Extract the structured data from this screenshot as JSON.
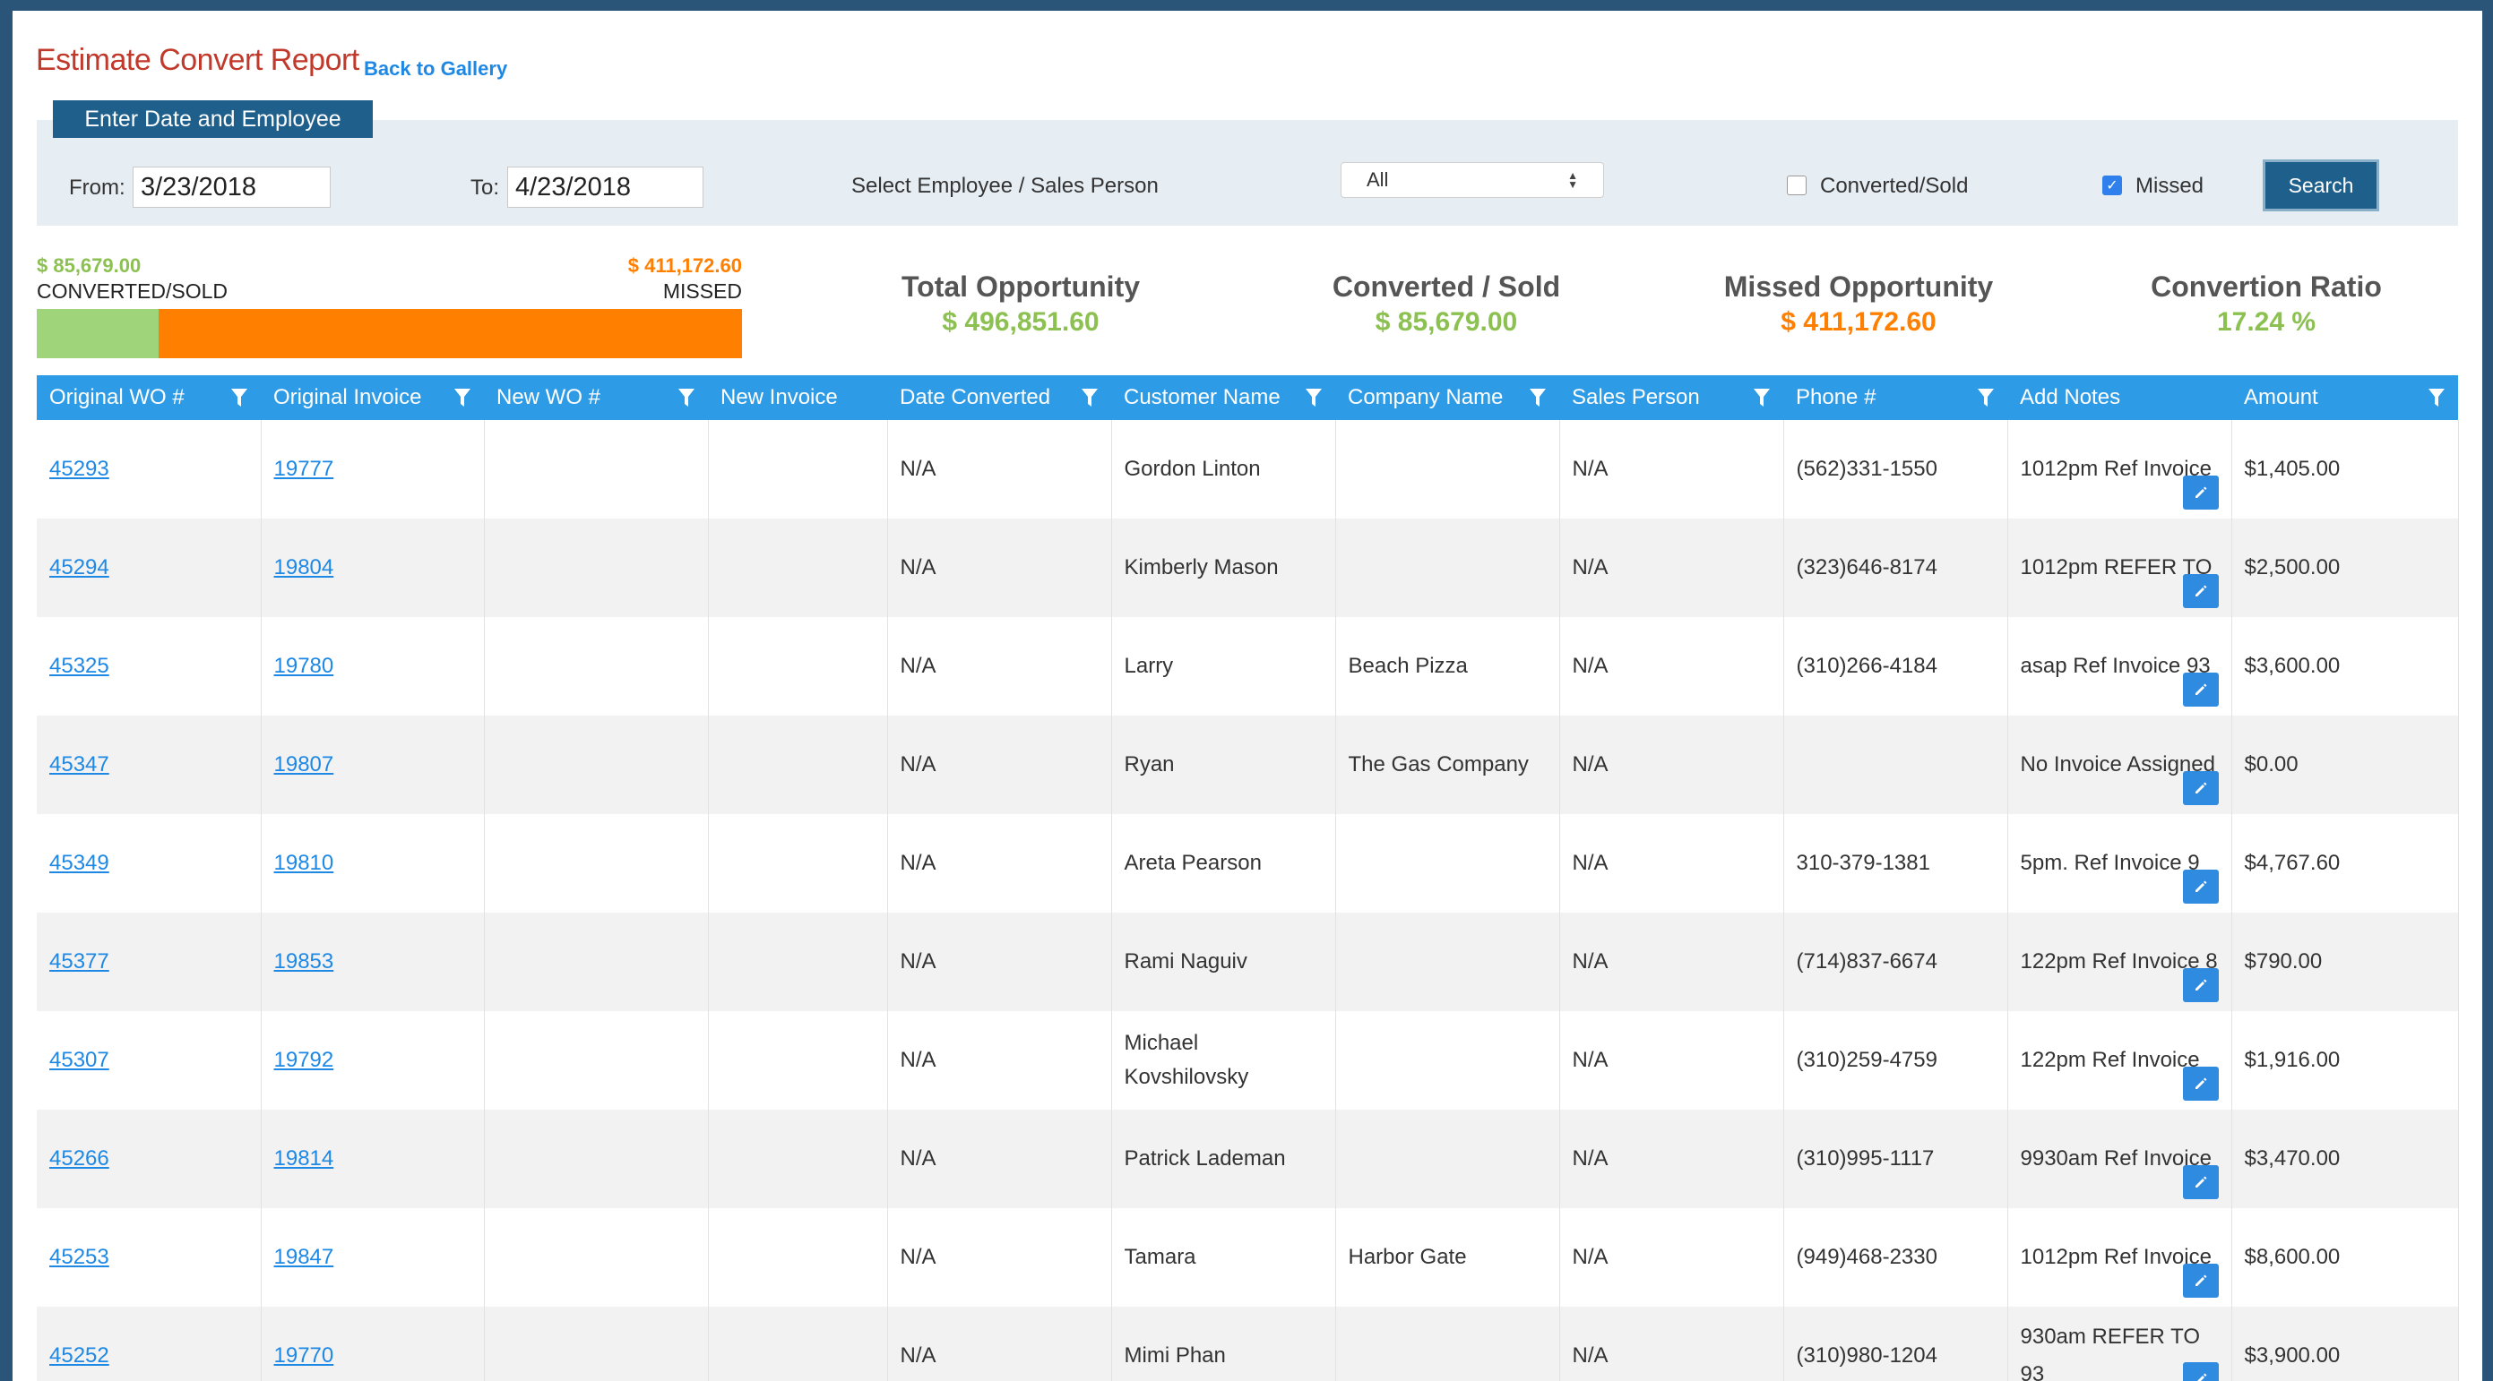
{
  "header": {
    "title": "Estimate Convert Report",
    "back_link": "Back to Gallery"
  },
  "filters": {
    "tab_label": "Enter Date and Employee",
    "from_label": "From:",
    "from_value": "3/23/2018",
    "to_label": "To:",
    "to_value": "4/23/2018",
    "employee_label": "Select Employee / Sales Person",
    "employee_selected": "All",
    "converted_label": "Converted/Sold",
    "converted_checked": false,
    "missed_label": "Missed",
    "missed_checked": true,
    "search_label": "Search"
  },
  "summary": {
    "converted_amount": "$ 85,679.00",
    "converted_label": "CONVERTED/SOLD",
    "missed_amount": "$ 411,172.60",
    "missed_label": "MISSED",
    "converted_fraction": 0.1724,
    "total_title": "Total Opportunity",
    "total_value": "$ 496,851.60",
    "converted_title": "Converted / Sold",
    "converted_value": "$ 85,679.00",
    "missed_title": "Missed Opportunity",
    "missed_value": "$ 411,172.60",
    "ratio_title": "Convertion Ratio",
    "ratio_value": "17.24 %",
    "colors": {
      "converted": "#8cc152",
      "missed": "#ff8000",
      "header": "#2e9be6"
    }
  },
  "table": {
    "columns": [
      {
        "label": "Original WO #",
        "filter": true
      },
      {
        "label": "Original Invoice",
        "filter": true
      },
      {
        "label": "New WO #",
        "filter": true
      },
      {
        "label": "New Invoice",
        "filter": false
      },
      {
        "label": "Date Converted",
        "filter": true
      },
      {
        "label": "Customer Name",
        "filter": true
      },
      {
        "label": "Company Name",
        "filter": true
      },
      {
        "label": "Sales Person",
        "filter": true
      },
      {
        "label": "Phone #",
        "filter": true
      },
      {
        "label": "Add Notes",
        "filter": false
      },
      {
        "label": "Amount",
        "filter": true
      }
    ],
    "rows": [
      {
        "wo": "45293",
        "invoice": "19777",
        "new_wo": "",
        "new_invoice": "",
        "date": "N/A",
        "customer": "Gordon Linton",
        "company": "",
        "sales": "N/A",
        "phone": "(562)331-1550",
        "notes": "1012pm Ref Invoice",
        "amount": "$1,405.00"
      },
      {
        "wo": "45294",
        "invoice": "19804",
        "new_wo": "",
        "new_invoice": "",
        "date": "N/A",
        "customer": "Kimberly Mason",
        "company": "",
        "sales": "N/A",
        "phone": "(323)646-8174",
        "notes": "1012pm REFER TO",
        "amount": "$2,500.00"
      },
      {
        "wo": "45325",
        "invoice": "19780",
        "new_wo": "",
        "new_invoice": "",
        "date": "N/A",
        "customer": "Larry",
        "company": "Beach Pizza",
        "sales": "N/A",
        "phone": "(310)266-4184",
        "notes": "asap Ref Invoice 93",
        "amount": "$3,600.00"
      },
      {
        "wo": "45347",
        "invoice": "19807",
        "new_wo": "",
        "new_invoice": "",
        "date": "N/A",
        "customer": "Ryan",
        "company": "The Gas Company",
        "sales": "N/A",
        "phone": "",
        "notes": "No Invoice Assigned",
        "amount": "$0.00"
      },
      {
        "wo": "45349",
        "invoice": "19810",
        "new_wo": "",
        "new_invoice": "",
        "date": "N/A",
        "customer": "Areta Pearson",
        "company": "",
        "sales": "N/A",
        "phone": "310-379-1381",
        "notes": "5pm. Ref Invoice 9",
        "amount": "$4,767.60"
      },
      {
        "wo": "45377",
        "invoice": "19853",
        "new_wo": "",
        "new_invoice": "",
        "date": "N/A",
        "customer": "Rami Naguiv",
        "company": "",
        "sales": "N/A",
        "phone": "(714)837-6674",
        "notes": "122pm Ref Invoice 8",
        "amount": "$790.00"
      },
      {
        "wo": "45307",
        "invoice": "19792",
        "new_wo": "",
        "new_invoice": "",
        "date": "N/A",
        "customer": "Michael Kovshilovsky",
        "company": "",
        "sales": "N/A",
        "phone": "(310)259-4759",
        "notes": "122pm Ref Invoice",
        "amount": "$1,916.00"
      },
      {
        "wo": "45266",
        "invoice": "19814",
        "new_wo": "",
        "new_invoice": "",
        "date": "N/A",
        "customer": "Patrick Lademan",
        "company": "",
        "sales": "N/A",
        "phone": "(310)995-1117",
        "notes": "9930am Ref Invoice",
        "amount": "$3,470.00"
      },
      {
        "wo": "45253",
        "invoice": "19847",
        "new_wo": "",
        "new_invoice": "",
        "date": "N/A",
        "customer": "Tamara",
        "company": "Harbor Gate",
        "sales": "N/A",
        "phone": "(949)468-2330",
        "notes": "1012pm Ref Invoice",
        "amount": "$8,600.00"
      },
      {
        "wo": "45252",
        "invoice": "19770",
        "new_wo": "",
        "new_invoice": "",
        "date": "N/A",
        "customer": "Mimi Phan",
        "company": "",
        "sales": "N/A",
        "phone": "(310)980-1204",
        "notes": "930am REFER TO 93",
        "amount": "$3,900.00"
      }
    ]
  }
}
